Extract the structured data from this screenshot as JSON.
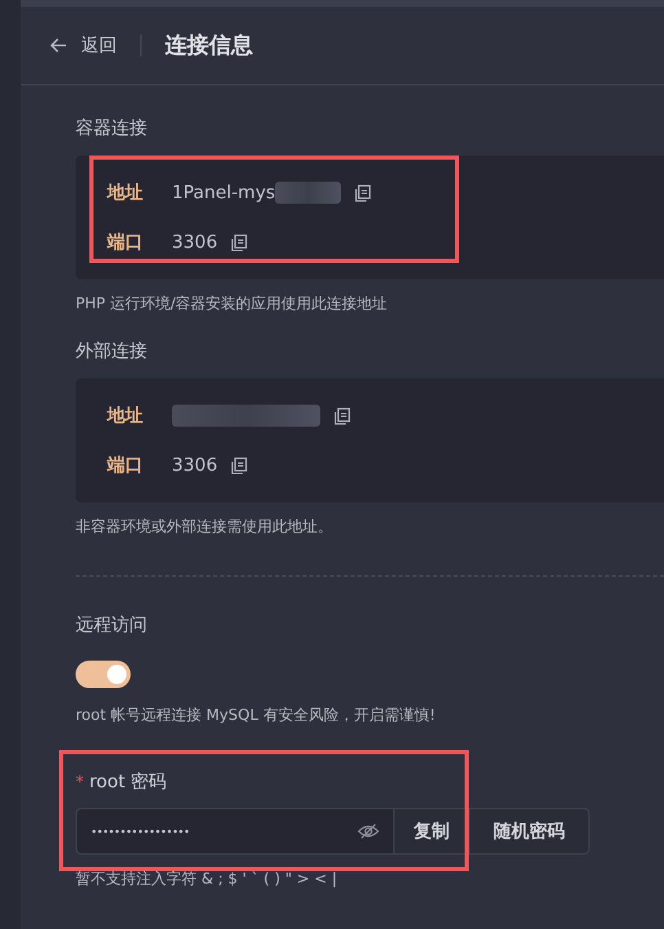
{
  "header": {
    "back": "返回",
    "title": "连接信息"
  },
  "sections": [
    {
      "title": "容器连接",
      "highlighted": true,
      "rows": [
        {
          "label": "地址",
          "value": "1Panel-mys",
          "redacted": true
        },
        {
          "label": "端口",
          "value": "3306",
          "redacted": false
        }
      ],
      "hint": "PHP 运行环境/容器安装的应用使用此连接地址"
    },
    {
      "title": "外部连接",
      "highlighted": false,
      "rows": [
        {
          "label": "地址",
          "value": "",
          "redacted": true
        },
        {
          "label": "端口",
          "value": "3306",
          "redacted": false
        }
      ],
      "hint": "非容器环境或外部连接需使用此地址。"
    }
  ],
  "remote": {
    "title": "远程访问",
    "on": true,
    "hint": "root 帐号远程连接 MySQL 有安全风险，开启需谨慎!"
  },
  "password": {
    "required": "*",
    "label": "root 密码",
    "value": "•••••••••••••••••",
    "highlighted": true,
    "buttons": [
      "复制",
      "随机密码"
    ],
    "hint": "暂不支持注入字符 & ; $ ' ` ( ) \" > < |"
  }
}
